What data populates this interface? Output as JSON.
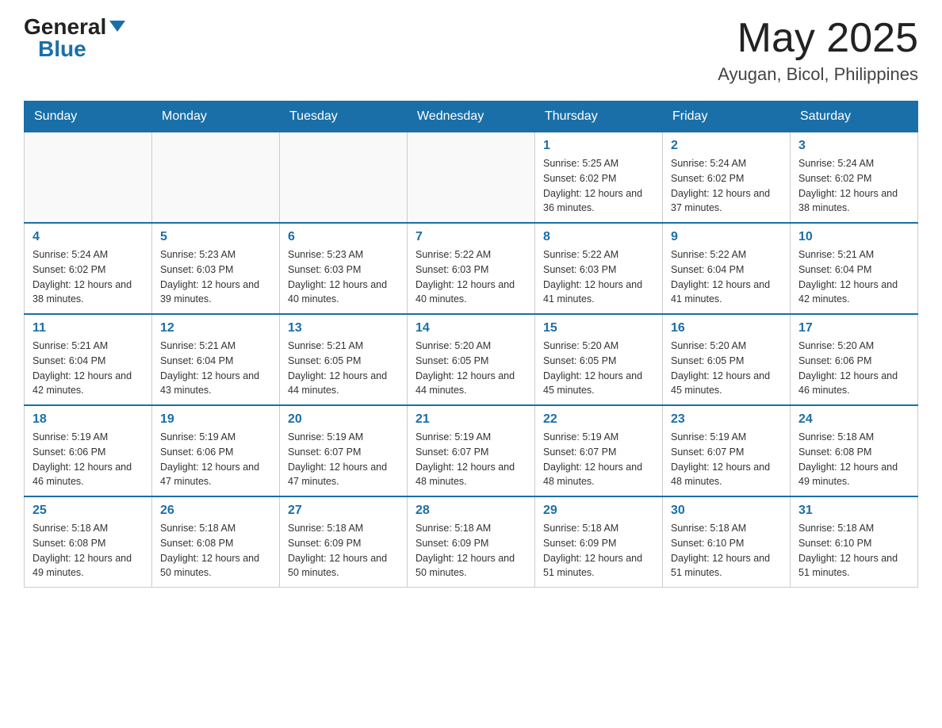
{
  "header": {
    "logo": {
      "general": "General",
      "blue": "Blue"
    },
    "month": "May 2025",
    "location": "Ayugan, Bicol, Philippines"
  },
  "weekdays": [
    "Sunday",
    "Monday",
    "Tuesday",
    "Wednesday",
    "Thursday",
    "Friday",
    "Saturday"
  ],
  "weeks": [
    [
      {
        "day": "",
        "info": ""
      },
      {
        "day": "",
        "info": ""
      },
      {
        "day": "",
        "info": ""
      },
      {
        "day": "",
        "info": ""
      },
      {
        "day": "1",
        "info": "Sunrise: 5:25 AM\nSunset: 6:02 PM\nDaylight: 12 hours and 36 minutes."
      },
      {
        "day": "2",
        "info": "Sunrise: 5:24 AM\nSunset: 6:02 PM\nDaylight: 12 hours and 37 minutes."
      },
      {
        "day": "3",
        "info": "Sunrise: 5:24 AM\nSunset: 6:02 PM\nDaylight: 12 hours and 38 minutes."
      }
    ],
    [
      {
        "day": "4",
        "info": "Sunrise: 5:24 AM\nSunset: 6:02 PM\nDaylight: 12 hours and 38 minutes."
      },
      {
        "day": "5",
        "info": "Sunrise: 5:23 AM\nSunset: 6:03 PM\nDaylight: 12 hours and 39 minutes."
      },
      {
        "day": "6",
        "info": "Sunrise: 5:23 AM\nSunset: 6:03 PM\nDaylight: 12 hours and 40 minutes."
      },
      {
        "day": "7",
        "info": "Sunrise: 5:22 AM\nSunset: 6:03 PM\nDaylight: 12 hours and 40 minutes."
      },
      {
        "day": "8",
        "info": "Sunrise: 5:22 AM\nSunset: 6:03 PM\nDaylight: 12 hours and 41 minutes."
      },
      {
        "day": "9",
        "info": "Sunrise: 5:22 AM\nSunset: 6:04 PM\nDaylight: 12 hours and 41 minutes."
      },
      {
        "day": "10",
        "info": "Sunrise: 5:21 AM\nSunset: 6:04 PM\nDaylight: 12 hours and 42 minutes."
      }
    ],
    [
      {
        "day": "11",
        "info": "Sunrise: 5:21 AM\nSunset: 6:04 PM\nDaylight: 12 hours and 42 minutes."
      },
      {
        "day": "12",
        "info": "Sunrise: 5:21 AM\nSunset: 6:04 PM\nDaylight: 12 hours and 43 minutes."
      },
      {
        "day": "13",
        "info": "Sunrise: 5:21 AM\nSunset: 6:05 PM\nDaylight: 12 hours and 44 minutes."
      },
      {
        "day": "14",
        "info": "Sunrise: 5:20 AM\nSunset: 6:05 PM\nDaylight: 12 hours and 44 minutes."
      },
      {
        "day": "15",
        "info": "Sunrise: 5:20 AM\nSunset: 6:05 PM\nDaylight: 12 hours and 45 minutes."
      },
      {
        "day": "16",
        "info": "Sunrise: 5:20 AM\nSunset: 6:05 PM\nDaylight: 12 hours and 45 minutes."
      },
      {
        "day": "17",
        "info": "Sunrise: 5:20 AM\nSunset: 6:06 PM\nDaylight: 12 hours and 46 minutes."
      }
    ],
    [
      {
        "day": "18",
        "info": "Sunrise: 5:19 AM\nSunset: 6:06 PM\nDaylight: 12 hours and 46 minutes."
      },
      {
        "day": "19",
        "info": "Sunrise: 5:19 AM\nSunset: 6:06 PM\nDaylight: 12 hours and 47 minutes."
      },
      {
        "day": "20",
        "info": "Sunrise: 5:19 AM\nSunset: 6:07 PM\nDaylight: 12 hours and 47 minutes."
      },
      {
        "day": "21",
        "info": "Sunrise: 5:19 AM\nSunset: 6:07 PM\nDaylight: 12 hours and 48 minutes."
      },
      {
        "day": "22",
        "info": "Sunrise: 5:19 AM\nSunset: 6:07 PM\nDaylight: 12 hours and 48 minutes."
      },
      {
        "day": "23",
        "info": "Sunrise: 5:19 AM\nSunset: 6:07 PM\nDaylight: 12 hours and 48 minutes."
      },
      {
        "day": "24",
        "info": "Sunrise: 5:18 AM\nSunset: 6:08 PM\nDaylight: 12 hours and 49 minutes."
      }
    ],
    [
      {
        "day": "25",
        "info": "Sunrise: 5:18 AM\nSunset: 6:08 PM\nDaylight: 12 hours and 49 minutes."
      },
      {
        "day": "26",
        "info": "Sunrise: 5:18 AM\nSunset: 6:08 PM\nDaylight: 12 hours and 50 minutes."
      },
      {
        "day": "27",
        "info": "Sunrise: 5:18 AM\nSunset: 6:09 PM\nDaylight: 12 hours and 50 minutes."
      },
      {
        "day": "28",
        "info": "Sunrise: 5:18 AM\nSunset: 6:09 PM\nDaylight: 12 hours and 50 minutes."
      },
      {
        "day": "29",
        "info": "Sunrise: 5:18 AM\nSunset: 6:09 PM\nDaylight: 12 hours and 51 minutes."
      },
      {
        "day": "30",
        "info": "Sunrise: 5:18 AM\nSunset: 6:10 PM\nDaylight: 12 hours and 51 minutes."
      },
      {
        "day": "31",
        "info": "Sunrise: 5:18 AM\nSunset: 6:10 PM\nDaylight: 12 hours and 51 minutes."
      }
    ]
  ]
}
